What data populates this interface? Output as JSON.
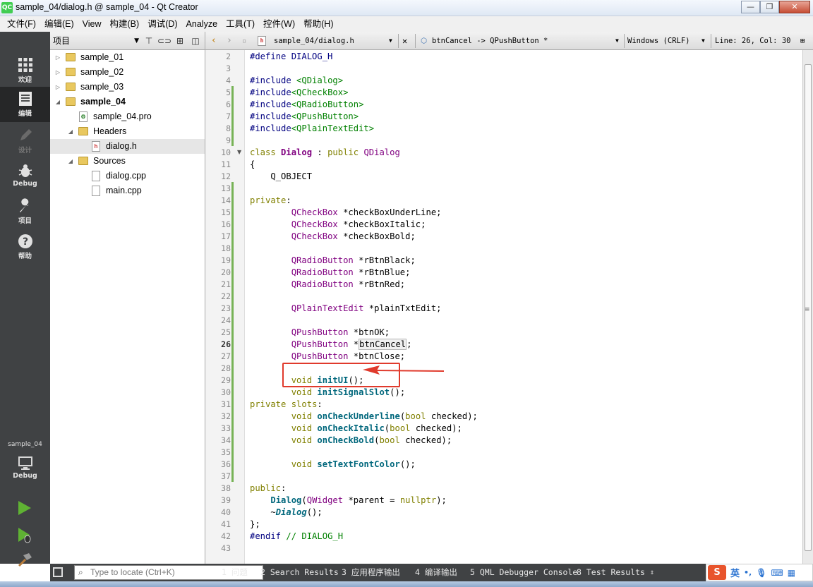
{
  "window": {
    "app_icon": "QC",
    "title": "sample_04/dialog.h @ sample_04 - Qt Creator",
    "min": "—",
    "max": "❐",
    "close": "✕"
  },
  "menu": [
    "文件(F)",
    "编辑(E)",
    "View",
    "构建(B)",
    "调试(D)",
    "Analyze",
    "工具(T)",
    "控件(W)",
    "帮助(H)"
  ],
  "modes": {
    "welcome": "欢迎",
    "edit": "编辑",
    "design": "设计",
    "debug": "Debug",
    "projects": "项目",
    "help": "帮助",
    "kit_project": "sample_04",
    "kit_build": "Debug"
  },
  "project_panel": {
    "title": "项目",
    "tree": [
      {
        "label": "sample_01",
        "bold": false,
        "icon": "project-folder-icon"
      },
      {
        "label": "sample_02",
        "bold": false,
        "icon": "project-folder-icon"
      },
      {
        "label": "sample_03",
        "bold": false,
        "icon": "project-folder-icon"
      },
      {
        "label": "sample_04",
        "bold": true,
        "icon": "project-folder-icon"
      },
      {
        "label": "sample_04.pro",
        "bold": false,
        "icon": "pro-file-icon"
      },
      {
        "label": "Headers",
        "bold": false,
        "icon": "headers-folder-icon"
      },
      {
        "label": "dialog.h",
        "bold": false,
        "icon": "header-file-icon"
      },
      {
        "label": "Sources",
        "bold": false,
        "icon": "sources-folder-icon"
      },
      {
        "label": "dialog.cpp",
        "bold": false,
        "icon": "cpp-file-icon"
      },
      {
        "label": "main.cpp",
        "bold": false,
        "icon": "cpp-file-icon"
      }
    ]
  },
  "editor_toolbar": {
    "file": "sample_04/dialog.h",
    "symbol": "btnCancel -> QPushButton *",
    "line_endings": "Windows (CRLF)",
    "position": "Line: 26, Col: 30"
  },
  "editor": {
    "current_line": 26,
    "lines": [
      {
        "n": "2",
        "html": "<span class=\"pp\">#define DIALOG_H</span>"
      },
      {
        "n": "3",
        "html": ""
      },
      {
        "n": "4",
        "html": "<span class=\"pp\">#include</span> <span class=\"str\">&lt;QDialog&gt;</span>"
      },
      {
        "n": "5",
        "html": "<span class=\"pp\">#include</span><span class=\"str\">&lt;QCheckBox&gt;</span>"
      },
      {
        "n": "6",
        "html": "<span class=\"pp\">#include</span><span class=\"str\">&lt;QRadioButton&gt;</span>"
      },
      {
        "n": "7",
        "html": "<span class=\"pp\">#include</span><span class=\"str\">&lt;QPushButton&gt;</span>"
      },
      {
        "n": "8",
        "html": "<span class=\"pp\">#include</span><span class=\"str\">&lt;QPlainTextEdit&gt;</span>"
      },
      {
        "n": "9",
        "html": ""
      },
      {
        "n": "10",
        "html": "<span class=\"kw\">class</span> <span class=\"cls\">Dialog</span> : <span class=\"kw\">public</span> <span class=\"ty\">QDialog</span>"
      },
      {
        "n": "11",
        "html": "{"
      },
      {
        "n": "12",
        "html": "    Q_OBJECT"
      },
      {
        "n": "13",
        "html": ""
      },
      {
        "n": "14",
        "html": "<span class=\"kw\">private</span>:"
      },
      {
        "n": "15",
        "html": "        <span class=\"ty\">QCheckBox</span> *checkBoxUnderLine;"
      },
      {
        "n": "16",
        "html": "        <span class=\"ty\">QCheckBox</span> *checkBoxItalic;"
      },
      {
        "n": "17",
        "html": "        <span class=\"ty\">QCheckBox</span> *checkBoxBold;"
      },
      {
        "n": "18",
        "html": ""
      },
      {
        "n": "19",
        "html": "        <span class=\"ty\">QRadioButton</span> *rBtnBlack;"
      },
      {
        "n": "20",
        "html": "        <span class=\"ty\">QRadioButton</span> *rBtnBlue;"
      },
      {
        "n": "21",
        "html": "        <span class=\"ty\">QRadioButton</span> *rBtnRed;"
      },
      {
        "n": "22",
        "html": ""
      },
      {
        "n": "23",
        "html": "        <span class=\"ty\">QPlainTextEdit</span> *plainTxtEdit;"
      },
      {
        "n": "24",
        "html": ""
      },
      {
        "n": "25",
        "html": "        <span class=\"ty\">QPushButton</span> *btnOK;"
      },
      {
        "n": "26",
        "html": "        <span class=\"ty\">QPushButton</span> *<span class=\"ref\">btnCancel</span>;"
      },
      {
        "n": "27",
        "html": "        <span class=\"ty\">QPushButton</span> *btnClose;"
      },
      {
        "n": "28",
        "html": ""
      },
      {
        "n": "29",
        "html": "        <span class=\"kw\">void</span> <span class=\"fn\">initUI</span>();"
      },
      {
        "n": "30",
        "html": "        <span class=\"kw\">void</span> <span class=\"fn\">initSignalSlot</span>();"
      },
      {
        "n": "31",
        "html": "<span class=\"kw\">private</span> <span class=\"kw\">slots</span>:"
      },
      {
        "n": "32",
        "html": "        <span class=\"kw\">void</span> <span class=\"fn\">onCheckUnderline</span>(<span class=\"kw\">bool</span> checked);"
      },
      {
        "n": "33",
        "html": "        <span class=\"kw\">void</span> <span class=\"fn\">onCheckItalic</span>(<span class=\"kw\">bool</span> checked);"
      },
      {
        "n": "34",
        "html": "        <span class=\"kw\">void</span> <span class=\"fn\">onCheckBold</span>(<span class=\"kw\">bool</span> checked);"
      },
      {
        "n": "35",
        "html": ""
      },
      {
        "n": "36",
        "html": "        <span class=\"kw\">void</span> <span class=\"fn\">setTextFontColor</span>();"
      },
      {
        "n": "37",
        "html": ""
      },
      {
        "n": "38",
        "html": "<span class=\"kw\">public</span>:"
      },
      {
        "n": "39",
        "html": "    <span class=\"fn\">Dialog</span>(<span class=\"ty\">QWidget</span> *parent = <span class=\"kw\">nullptr</span>);"
      },
      {
        "n": "40",
        "html": "    ~<span class=\"fn it\">Dialog</span>();"
      },
      {
        "n": "41",
        "html": "};"
      },
      {
        "n": "42",
        "html": "<span class=\"pp\">#endif</span> <span class=\"str\">// DIALOG_H</span>"
      },
      {
        "n": "43",
        "html": ""
      }
    ]
  },
  "bottom": {
    "locator_placeholder": "Type to locate (Ctrl+K)",
    "panes": [
      "1 问题",
      "2 Search Results",
      "3 应用程序输出",
      "4 编译输出",
      "5 QML Debugger Console",
      "8 Test Results"
    ]
  },
  "ime": {
    "logo": "S",
    "lang": "英"
  },
  "colors": {
    "accent_annotation": "#e03a2c",
    "modebar": "#404244",
    "change_bar": "#77b256"
  }
}
